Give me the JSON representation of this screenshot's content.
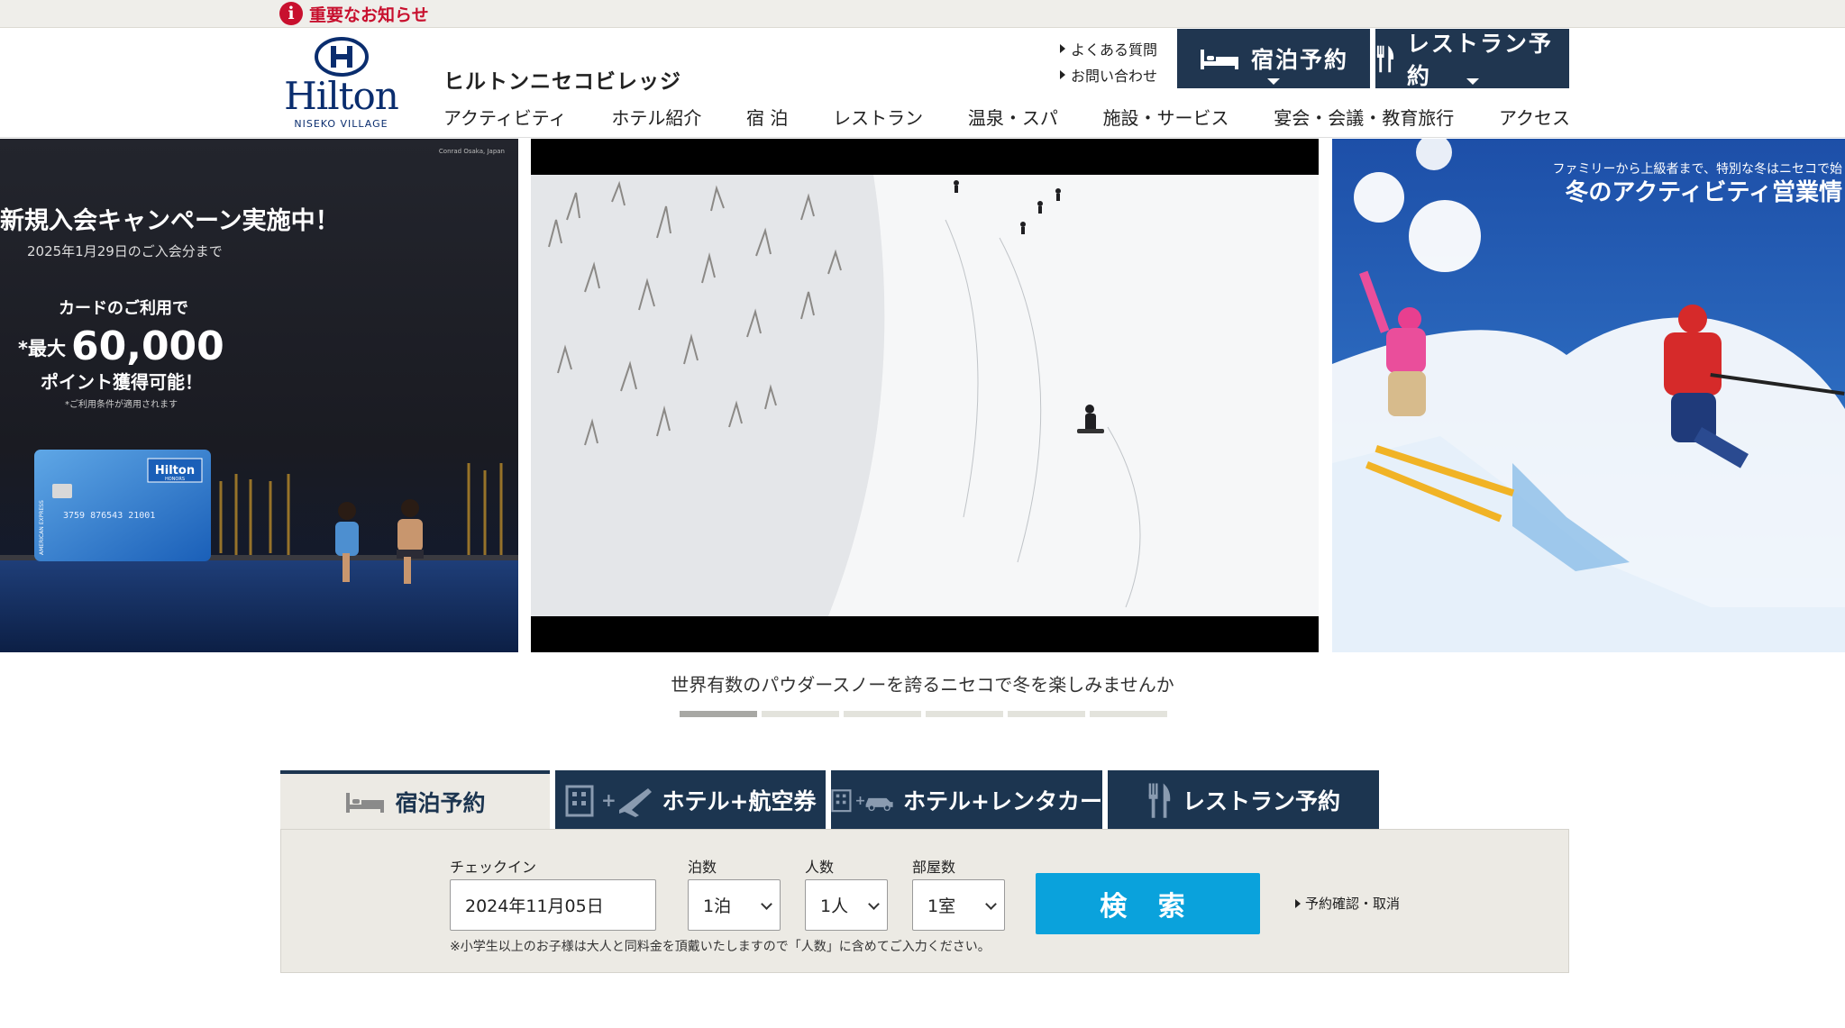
{
  "notice": {
    "icon": "info-icon",
    "text": "重要なお知らせ",
    "color": "#c8102e"
  },
  "header": {
    "logo_word": "Hilton",
    "logo_sub": "NISEKO VILLAGE",
    "hotel_name": "ヒルトンニセコビレッジ",
    "util_links": [
      "よくある質問",
      "お問い合わせ"
    ],
    "stay_button": "宿泊予約",
    "restaurant_button": "レストラン予約",
    "accent_color": "#203650"
  },
  "nav": [
    "アクティビティ",
    "ホテル紹介",
    "宿 泊",
    "レストラン",
    "温泉・スパ",
    "施設・サービス",
    "宴会・会議・教育旅行",
    "アクセス"
  ],
  "hero": {
    "left_slide": {
      "corner": "Conrad Osaka, Japan",
      "headline": "新規入会キャンペーン実施中！",
      "deadline": "2025年1月29日のご入会分まで",
      "line1": "カードのご利用で",
      "max_prefix": "*最大",
      "points": "60,000",
      "line3": "ポイント獲得可能！",
      "disclaimer": "*ご利用条件が適用されます",
      "card_brand": "Hilton",
      "card_sub": "HONORS",
      "card_issuer": "AMERICAN EXPRESS",
      "card_number": "3759 876543 21001"
    },
    "right_slide": {
      "subtitle": "ファミリーから上級者まで、特別な冬はニセコで始",
      "title": "冬のアクティビティ営業情"
    },
    "caption": "世界有数のパウダースノーを誇るニセコで冬を楽しみませんか",
    "dots_total": 6,
    "dots_active": 1
  },
  "booking": {
    "tabs": [
      {
        "label": "宿泊予約",
        "icon": "bed-icon",
        "active": true
      },
      {
        "label": "ホテル+航空券",
        "icon": "building-plane-icon",
        "active": false
      },
      {
        "label": "ホテル+レンタカー",
        "icon": "building-car-icon",
        "active": false
      },
      {
        "label": "レストラン予約",
        "icon": "fork-knife-icon",
        "active": false
      }
    ],
    "checkin_label": "チェックイン",
    "checkin_value": "2024年11月05日",
    "nights_label": "泊数",
    "nights_value": "1泊",
    "guests_label": "人数",
    "guests_value": "1人",
    "rooms_label": "部屋数",
    "rooms_value": "1室",
    "search_button": "検 索",
    "search_color": "#0aa2dc",
    "confirm_link": "予約確認・取消",
    "note": "※小学生以上のお子様は大人と同料金を頂戴いたしますので「人数」に含めてご入力ください。"
  }
}
